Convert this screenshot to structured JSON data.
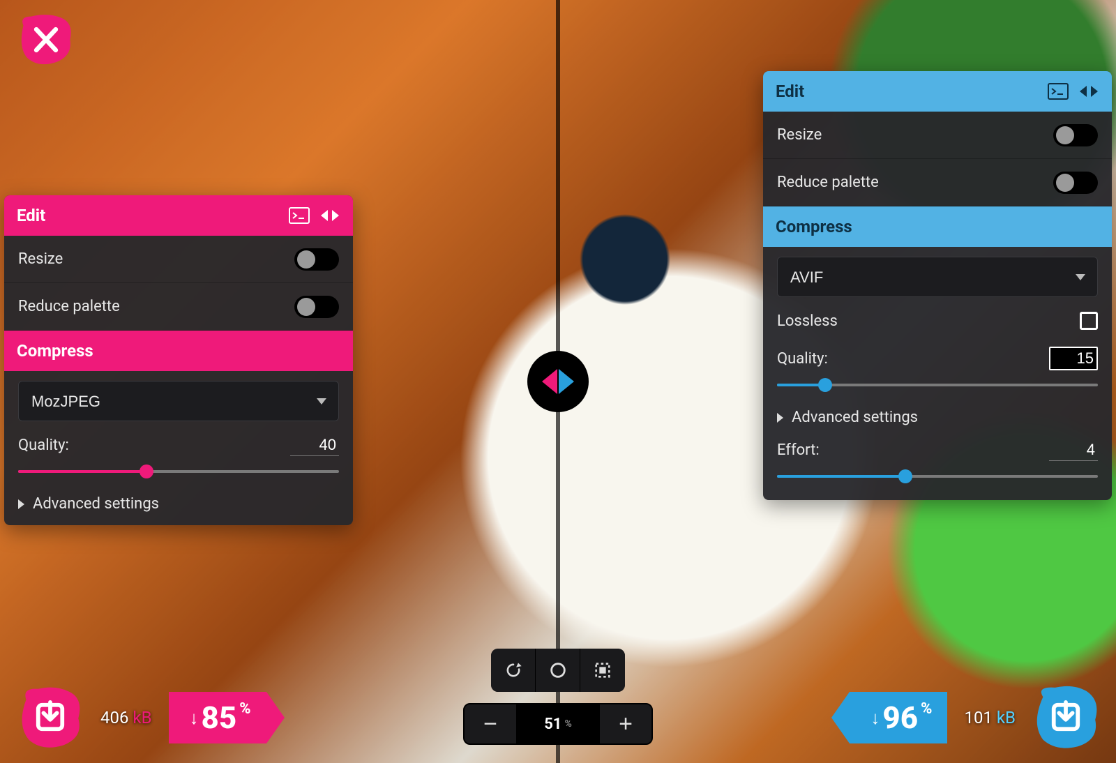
{
  "colors": {
    "pink": "#ef1a7a",
    "blue": "#29a0de",
    "blueLight": "#52b2e4"
  },
  "left": {
    "edit_title": "Edit",
    "resize_label": "Resize",
    "resize_on": false,
    "reduce_palette_label": "Reduce palette",
    "reduce_palette_on": false,
    "compress_title": "Compress",
    "codec": "MozJPEG",
    "quality_label": "Quality:",
    "quality_value": "40",
    "quality_percent": 40,
    "advanced_label": "Advanced settings",
    "result_size": "406",
    "result_unit": "kB",
    "reduction_pct": "85"
  },
  "right": {
    "edit_title": "Edit",
    "resize_label": "Resize",
    "resize_on": false,
    "reduce_palette_label": "Reduce palette",
    "reduce_palette_on": false,
    "compress_title": "Compress",
    "codec": "AVIF",
    "lossless_label": "Lossless",
    "lossless_on": false,
    "quality_label": "Quality:",
    "quality_value": "15",
    "quality_percent": 15,
    "advanced_label": "Advanced settings",
    "effort_label": "Effort:",
    "effort_value": "4",
    "effort_percent": 40,
    "result_size": "101",
    "result_unit": "kB",
    "reduction_pct": "96"
  },
  "zoom": {
    "value": "51",
    "unit": "%"
  }
}
